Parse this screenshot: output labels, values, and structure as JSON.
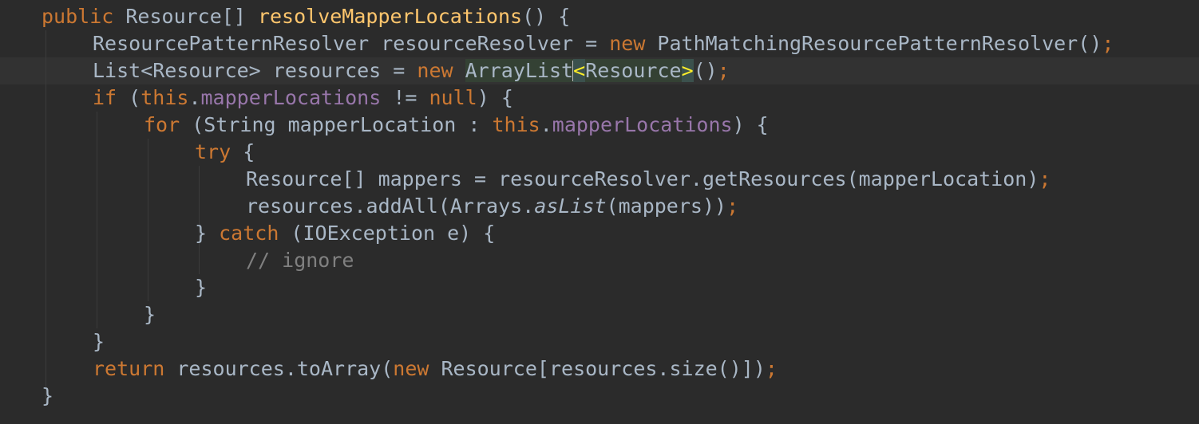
{
  "editor": {
    "background": "#2B2B2B",
    "current_line_background": "#323232",
    "syntax_colors": {
      "keyword": "#CC7832",
      "method_declaration": "#FFC66D",
      "field": "#9876AA",
      "comment": "#808080",
      "default_text": "#A9B7C6",
      "matched_bracket": "#FFEF28"
    },
    "lines": [
      [
        "public",
        " Resource[] ",
        "resolveMapperLocations",
        "() {"
      ],
      [
        "ResourcePatternResolver resourceResolver = ",
        "new",
        " PathMatchingResourcePatternResolver()",
        ";"
      ],
      [
        "List<Resource> resources = ",
        "new",
        " ",
        "ArrayList",
        "<",
        "Resource",
        ">",
        "()",
        ";"
      ],
      [
        "if",
        " (",
        "this",
        ".",
        "mapperLocations",
        " != ",
        "null",
        ") {"
      ],
      [
        "for",
        " (String mapperLocation : ",
        "this",
        ".",
        "mapperLocations",
        ") {"
      ],
      [
        "try",
        " {"
      ],
      [
        "Resource[] mappers = resourceResolver.getResources(mapperLocation)",
        ";"
      ],
      [
        "resources.addAll(Arrays.",
        "asList",
        "(mappers))",
        ";"
      ],
      [
        "} ",
        "catch",
        " (IOException e) {"
      ],
      [
        "// ignore"
      ],
      [
        "}"
      ],
      [
        "}"
      ],
      [
        "}"
      ],
      [
        "return",
        " resources.toArray(",
        "new",
        " Resource[resources.size()])",
        ";"
      ],
      [
        "}"
      ]
    ]
  }
}
